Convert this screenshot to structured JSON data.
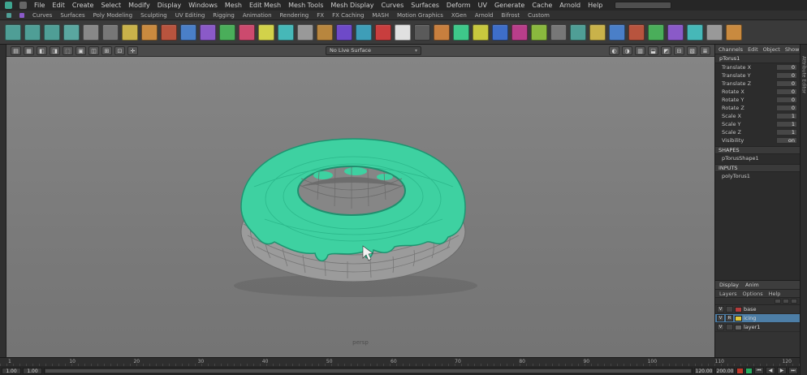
{
  "menu_bar": {
    "items": [
      "File",
      "Edit",
      "Create",
      "Select",
      "Modify",
      "Display",
      "Windows",
      "Mesh",
      "Edit Mesh",
      "Mesh Tools",
      "Mesh Display",
      "Curves",
      "Surfaces",
      "Deform",
      "UV",
      "Generate",
      "Cache",
      "Arnold",
      "Help"
    ]
  },
  "status_line": {
    "field_value": ""
  },
  "shelf": {
    "tabs": [
      "Curves",
      "Surfaces",
      "Poly Modeling",
      "Sculpting",
      "UV Editing",
      "Rigging",
      "Animation",
      "Rendering",
      "FX",
      "FX Caching",
      "MASH",
      "Motion Graphics",
      "XGen",
      "Arnold",
      "Bifrost",
      "Custom"
    ],
    "icons": [
      "#4f9e96",
      "#4f9e96",
      "#4f9e96",
      "#5aa7a0",
      "#888888",
      "#777777",
      "#c9b24a",
      "#c98a3f",
      "#b8543e",
      "#4a7fc8",
      "#8a5ac8",
      "#4aae5a",
      "#cc4a6e",
      "#d2d24a",
      "#46b8b8",
      "#999999",
      "#b8863e",
      "#6e4ac8",
      "#3e9eb8",
      "#c83e3e",
      "#e0e0e0",
      "#5a5a5a",
      "#c87f3e",
      "#3ec88a",
      "#c8c83e",
      "#3e6ec8",
      "#b83e8a",
      "#8ab83e",
      "#777777",
      "#4f9e96",
      "#c9b24a",
      "#4a7fc8",
      "#b8543e",
      "#4aae5a",
      "#8a5ac8",
      "#46b8b8",
      "#999999",
      "#c98a3f"
    ]
  },
  "viewport_toolbar": {
    "left_icons": [
      "▤",
      "▦",
      "◧",
      "◨",
      "⬚",
      "▣",
      "◫",
      "⊞",
      "⊡",
      "✛"
    ],
    "dropdown_value": "No Live Surface",
    "right_icons": [
      "◐",
      "◑",
      "▥",
      "⬓",
      "◩",
      "⊟",
      "▧",
      "≣"
    ]
  },
  "viewport": {
    "camera_label": "persp"
  },
  "side_strip": {
    "vertical_label": "Attribute Editor"
  },
  "channel_box": {
    "tabs": [
      "Channels",
      "Edit",
      "Object",
      "Show"
    ],
    "object_name": "pTorus1",
    "channels": [
      {
        "label": "Translate X",
        "value": "0"
      },
      {
        "label": "Translate Y",
        "value": "0"
      },
      {
        "label": "Translate Z",
        "value": "0"
      },
      {
        "label": "Rotate X",
        "value": "0"
      },
      {
        "label": "Rotate Y",
        "value": "0"
      },
      {
        "label": "Rotate Z",
        "value": "0"
      },
      {
        "label": "Scale X",
        "value": "1"
      },
      {
        "label": "Scale Y",
        "value": "1"
      },
      {
        "label": "Scale Z",
        "value": "1"
      },
      {
        "label": "Visibility",
        "value": "on"
      }
    ],
    "shapes_header": "SHAPES",
    "shape_name": "pTorusShape1",
    "inputs_header": "INPUTS",
    "input_name": "polyTorus1"
  },
  "layer_editor": {
    "tabs": [
      "Display",
      "Anim"
    ],
    "menu_items": [
      "Layers",
      "Options",
      "Help"
    ],
    "layers": [
      {
        "vis": "V",
        "mode": "",
        "color": "#b43c3c",
        "name": "base",
        "bg": ""
      },
      {
        "vis": "V",
        "mode": "R",
        "color": "#e3c93a",
        "name": "icing",
        "bg": "#4d7ea6"
      },
      {
        "vis": "V",
        "mode": "",
        "color": "#666666",
        "name": "layer1",
        "bg": ""
      }
    ]
  },
  "timeline": {
    "ticks": [
      "1",
      "10",
      "20",
      "30",
      "40",
      "50",
      "60",
      "70",
      "80",
      "90",
      "100",
      "110",
      "120"
    ]
  },
  "range_slider": {
    "playback_start": "1.00",
    "anim_start": "1.00",
    "anim_end": "120.00",
    "playback_end": "200.00"
  },
  "playback": {
    "buttons": [
      "⏮",
      "◀",
      "▶",
      "⏭"
    ],
    "key_buttons": [
      {
        "c": "#c0392b"
      },
      {
        "c": "#27ae60"
      }
    ]
  }
}
